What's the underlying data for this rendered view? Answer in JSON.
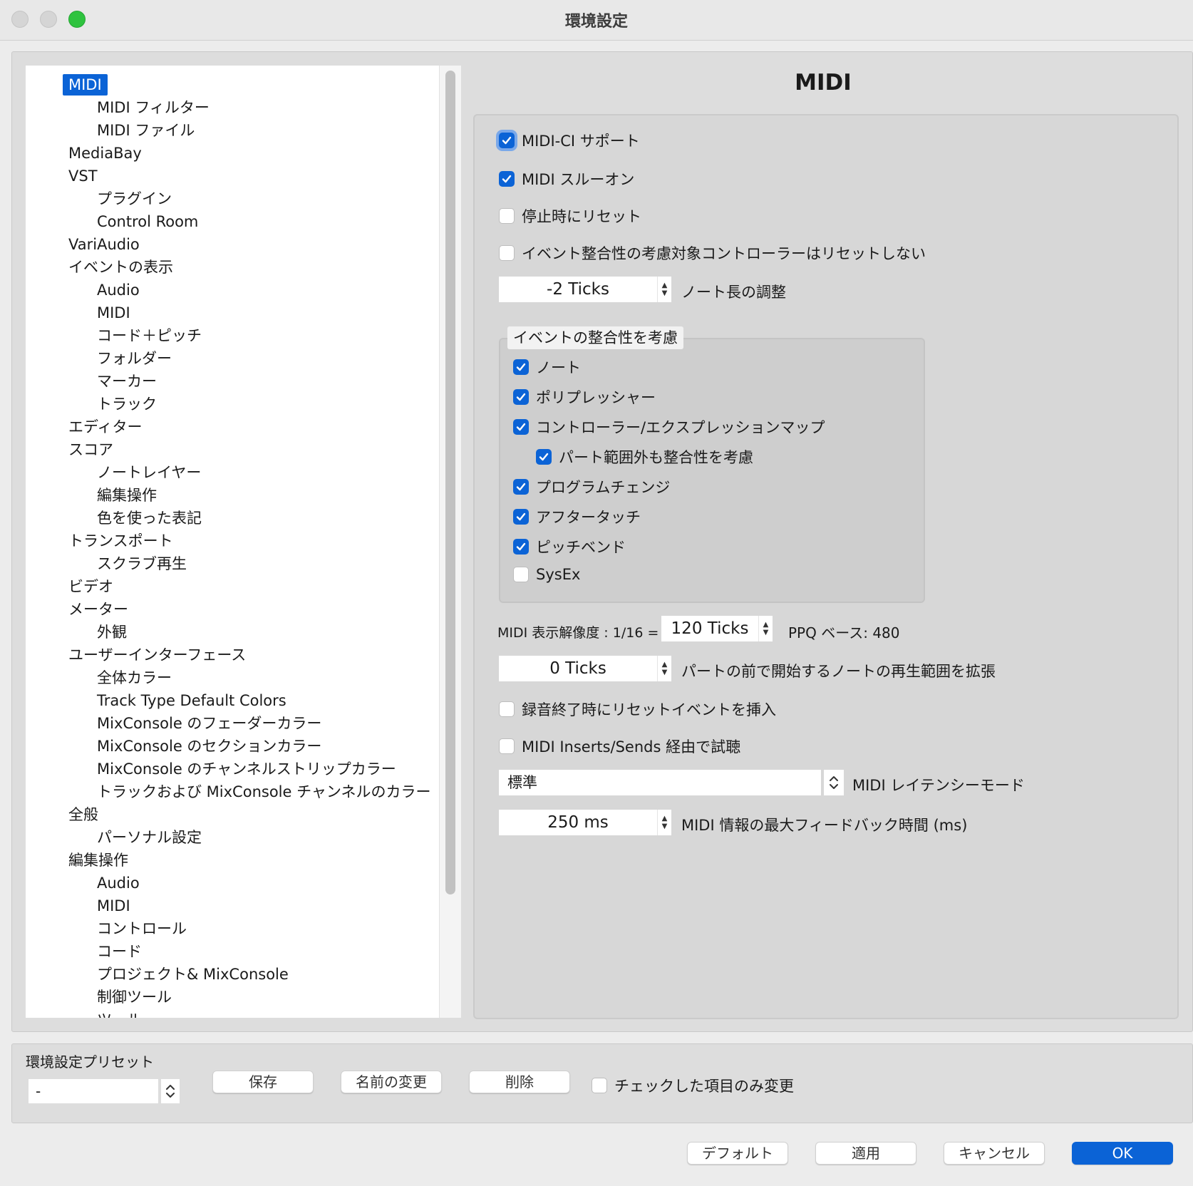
{
  "window": {
    "title": "環境設定"
  },
  "colors": {
    "accent": "#0b63d6",
    "close": "#d5d5d5",
    "minimize": "#d5d5d5",
    "zoom": "#2fc33f"
  },
  "tree": [
    {
      "label": "MIDI",
      "level": 0,
      "selected": true
    },
    {
      "label": "MIDI フィルター",
      "level": 1
    },
    {
      "label": "MIDI ファイル",
      "level": 1
    },
    {
      "label": "MediaBay",
      "level": 0
    },
    {
      "label": "VST",
      "level": 0
    },
    {
      "label": "プラグイン",
      "level": 1
    },
    {
      "label": "Control Room",
      "level": 1
    },
    {
      "label": "VariAudio",
      "level": 0
    },
    {
      "label": "イベントの表示",
      "level": 0
    },
    {
      "label": "Audio",
      "level": 1
    },
    {
      "label": "MIDI",
      "level": 1
    },
    {
      "label": "コード＋ピッチ",
      "level": 1
    },
    {
      "label": "フォルダー",
      "level": 1
    },
    {
      "label": "マーカー",
      "level": 1
    },
    {
      "label": "トラック",
      "level": 1
    },
    {
      "label": "エディター",
      "level": 0
    },
    {
      "label": "スコア",
      "level": 0
    },
    {
      "label": "ノートレイヤー",
      "level": 1
    },
    {
      "label": "編集操作",
      "level": 1
    },
    {
      "label": "色を使った表記",
      "level": 1
    },
    {
      "label": "トランスポート",
      "level": 0
    },
    {
      "label": "スクラブ再生",
      "level": 1
    },
    {
      "label": "ビデオ",
      "level": 0
    },
    {
      "label": "メーター",
      "level": 0
    },
    {
      "label": "外観",
      "level": 1
    },
    {
      "label": "ユーザーインターフェース",
      "level": 0
    },
    {
      "label": "全体カラー",
      "level": 1
    },
    {
      "label": "Track Type Default Colors",
      "level": 1
    },
    {
      "label": "MixConsole のフェーダーカラー",
      "level": 1
    },
    {
      "label": "MixConsole のセクションカラー",
      "level": 1
    },
    {
      "label": "MixConsole のチャンネルストリップカラー",
      "level": 1
    },
    {
      "label": "トラックおよび MixConsole チャンネルのカラー",
      "level": 1
    },
    {
      "label": "全般",
      "level": 0
    },
    {
      "label": "パーソナル設定",
      "level": 1
    },
    {
      "label": "編集操作",
      "level": 0
    },
    {
      "label": "Audio",
      "level": 1
    },
    {
      "label": "MIDI",
      "level": 1
    },
    {
      "label": "コントロール",
      "level": 1
    },
    {
      "label": "コード",
      "level": 1
    },
    {
      "label": "プロジェクト& MixConsole",
      "level": 1
    },
    {
      "label": "制御ツール",
      "level": 1
    },
    {
      "label": "ツール",
      "level": 1
    }
  ],
  "panel": {
    "title": "MIDI",
    "midi_ci": {
      "label": "MIDI-CI サポート",
      "checked": true
    },
    "midi_thru": {
      "label": "MIDI スルーオン",
      "checked": true
    },
    "reset_on_stop": {
      "label": "停止時にリセット",
      "checked": false
    },
    "no_reset_chase": {
      "label": "イベント整合性の考慮対象コントローラーはリセットしない",
      "checked": false
    },
    "length_adjust": {
      "value": "-2 Ticks",
      "label": "ノート長の調整"
    },
    "chase_group": {
      "title": "イベントの整合性を考慮",
      "items": [
        {
          "label": "ノート",
          "checked": true
        },
        {
          "label": "ポリプレッシャー",
          "checked": true
        },
        {
          "label": "コントローラー/エクスプレッションマップ",
          "checked": true
        },
        {
          "label": "パート範囲外も整合性を考慮",
          "checked": true
        },
        {
          "label": "プログラムチェンジ",
          "checked": true
        },
        {
          "label": "アフタータッチ",
          "checked": true
        },
        {
          "label": "ピッチベンド",
          "checked": true
        },
        {
          "label": "SysEx",
          "checked": false
        }
      ]
    },
    "display_resolution": {
      "label": "MIDI 表示解像度 : 1/16 =",
      "value": "120 Ticks",
      "ppq": "PPQ ベース: 480"
    },
    "extend_playback": {
      "value": "0 Ticks",
      "label": "パートの前で開始するノートの再生範囲を拡張"
    },
    "insert_reset": {
      "label": "録音終了時にリセットイベントを挿入",
      "checked": false
    },
    "audition_inserts": {
      "label": "MIDI Inserts/Sends 経由で試聴",
      "checked": false
    },
    "latency_mode": {
      "value": "標準",
      "label": "MIDI レイテンシーモード"
    },
    "max_feedback": {
      "value": "250 ms",
      "label": "MIDI 情報の最大フィードバック時間 (ms)"
    }
  },
  "presets": {
    "title": "環境設定プリセット",
    "value": "-",
    "save": "保存",
    "rename": "名前の変更",
    "delete": "削除",
    "only_checked": {
      "label": "チェックした項目のみ変更",
      "checked": false
    }
  },
  "footer": {
    "default": "デフォルト",
    "apply": "適用",
    "cancel": "キャンセル",
    "ok": "OK"
  }
}
